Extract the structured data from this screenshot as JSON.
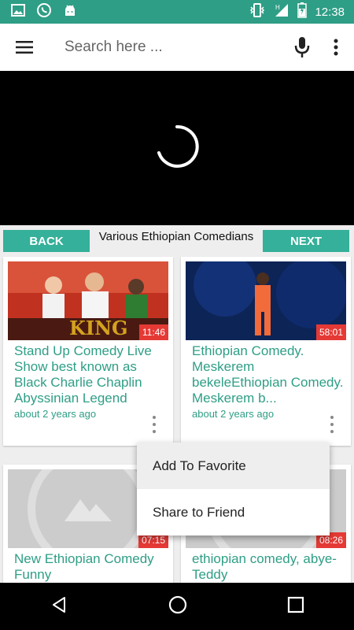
{
  "status_bar": {
    "time": "12:38",
    "icons": [
      "gallery-icon",
      "viber-icon",
      "android-icon",
      "vibrate-icon",
      "signal-icon",
      "battery-icon"
    ]
  },
  "app_bar": {
    "search_placeholder": "Search here ...",
    "menu_icon": "hamburger-icon",
    "mic_icon": "mic-icon",
    "overflow_icon": "more-vert-icon"
  },
  "player": {
    "state": "loading"
  },
  "nav": {
    "back_label": "BACK",
    "next_label": "NEXT",
    "title": "Various Ethiopian Comedians"
  },
  "videos": [
    {
      "title": "Stand Up Comedy Live Show best known as Black Charlie Chaplin Abyssinian Legend",
      "title_display": "Stand Up Comedy Live Show best known as Black Charlie Chaplin Abyssinian Legend",
      "meta": "about 2 years ago",
      "duration": "11:46"
    },
    {
      "title": "Ethiopian Comedy. Meskerem bekeleEthiopian Comedy. Meskerem b...",
      "title_display": "Ethiopian Comedy. Meskerem bekeleEthiopian Comedy. Meskerem b...",
      "meta": "about 2 years ago",
      "duration": "58:01"
    },
    {
      "title": "New Ethiopian Comedy Funny",
      "title_display": "New Ethiopian Comedy Funny",
      "meta": "",
      "duration": "07:15"
    },
    {
      "title": "ethiopian comedy, abye-Teddy",
      "title_display": "ethiopian comedy, abye-Teddy",
      "meta": "",
      "duration": "08:26"
    }
  ],
  "popup_menu": {
    "items": [
      "Add To Favorite",
      "Share to Friend"
    ]
  },
  "colors": {
    "accent": "#2e9e86",
    "button": "#35b09a",
    "duration_badge": "#e53935"
  }
}
